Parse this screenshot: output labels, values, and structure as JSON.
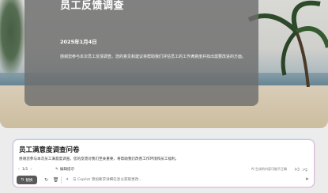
{
  "preview": {
    "title": "员工反馈调查",
    "date": "2025年1月4日",
    "body": "感谢您参与本次员工反馈调查。您的意见和建议将帮助我们评估员工的工作满意度并找出需要改进的方面。"
  },
  "editor": {
    "title": "员工满意度调查问卷",
    "description": "感谢您参与本次员工满意度调查。您的反馈对我们至关重要，将帮助我们改善工作环境和员工福利。",
    "pager": "1/1",
    "edit_hint": "编辑提示",
    "ai_note": "AI 生成的内容可能不正确",
    "replace_label": "替换",
    "prompt_placeholder": "与 Copilot 添加要求详细信息以获取更改..."
  },
  "icons": {
    "prev": "chevron-left-icon",
    "next": "chevron-right-icon",
    "edit": "pencil-icon",
    "refresh": "refresh-icon",
    "delete": "trash-icon",
    "replace": "replace-icon",
    "thumbs_up": "thumbs-up-icon",
    "thumbs_down": "thumbs-down-icon",
    "copilot": "copilot-icon",
    "send": "send-icon"
  },
  "colors": {
    "card_overlay": "#6e6e6e",
    "editor_border": "#e8b7cf",
    "replace_button": "#5a5a5a",
    "copilot_accent": "#7a6fd8"
  }
}
